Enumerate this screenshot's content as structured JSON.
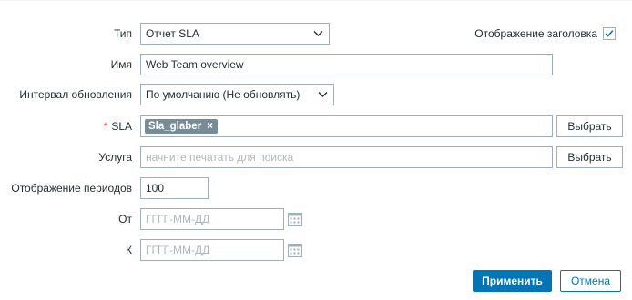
{
  "form": {
    "type": {
      "label": "Тип",
      "value": "Отчет SLA"
    },
    "show_header": {
      "label": "Отображение заголовка",
      "checked": true
    },
    "name": {
      "label": "Имя",
      "value": "Web Team overview"
    },
    "refresh": {
      "label": "Интервал обновления",
      "value": "По умолчанию (Не обновлять)"
    },
    "sla": {
      "label": "SLA",
      "required_mark": "*",
      "chip": "Sla_glaber",
      "chip_remove": "×",
      "select_button": "Выбрать"
    },
    "service": {
      "label": "Услуга",
      "placeholder": "начните печатать для поиска",
      "select_button": "Выбрать"
    },
    "periods": {
      "label": "Отображение периодов",
      "value": "100"
    },
    "from": {
      "label": "От",
      "placeholder": "ГГГГ-ММ-ДД"
    },
    "to": {
      "label": "К",
      "placeholder": "ГГГГ-ММ-ДД"
    }
  },
  "buttons": {
    "apply": "Применить",
    "cancel": "Отмена"
  },
  "colors": {
    "primary": "#0275b8",
    "chip": "#768d99",
    "border": "#9fafb8",
    "required": "#e45959"
  }
}
